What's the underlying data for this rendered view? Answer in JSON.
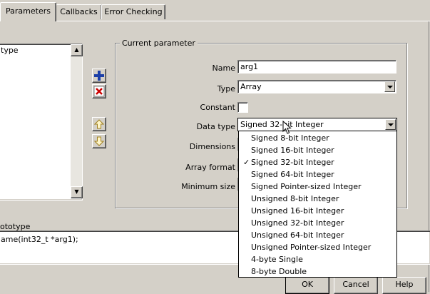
{
  "tabs": [
    {
      "label": "Parameters",
      "active": true
    },
    {
      "label": "Callbacks",
      "active": false
    },
    {
      "label": "Error Checking",
      "active": false
    }
  ],
  "param_list": {
    "items": [
      "type"
    ]
  },
  "group": {
    "title": "Current parameter"
  },
  "fields": {
    "name_label": "Name",
    "name_value": "arg1",
    "type_label": "Type",
    "type_value": "Array",
    "constant_label": "Constant",
    "datatype_label": "Data type",
    "datatype_value": "Signed 32-bit Integer",
    "dimensions_label": "Dimensions",
    "arrayformat_label": "Array format",
    "minsize_label": "Minimum size"
  },
  "dropdown_options": [
    {
      "label": "Signed 8-bit Integer",
      "checked": false
    },
    {
      "label": "Signed 16-bit Integer",
      "checked": false
    },
    {
      "label": "Signed 32-bit Integer",
      "checked": true
    },
    {
      "label": "Signed 64-bit Integer",
      "checked": false
    },
    {
      "label": "Signed Pointer-sized Integer",
      "checked": false
    },
    {
      "label": "Unsigned 8-bit Integer",
      "checked": false
    },
    {
      "label": "Unsigned 16-bit Integer",
      "checked": false
    },
    {
      "label": "Unsigned 32-bit Integer",
      "checked": false
    },
    {
      "label": "Unsigned 64-bit Integer",
      "checked": false
    },
    {
      "label": "Unsigned Pointer-sized Integer",
      "checked": false
    },
    {
      "label": "4-byte Single",
      "checked": false
    },
    {
      "label": "8-byte Double",
      "checked": false
    }
  ],
  "prototype": {
    "label": "ototype",
    "text": "ame(int32_t *arg1);"
  },
  "buttons": {
    "ok": "OK",
    "cancel": "Cancel",
    "help": "Help"
  },
  "icons": {
    "add": "plus-icon",
    "delete": "x-delete-icon",
    "up": "arrow-up-icon",
    "down": "arrow-down-icon",
    "check": "✓"
  },
  "colors": {
    "accent_blue": "#1c3fa8",
    "delete_red": "#cc0000",
    "arrow_green": "#c8a020"
  }
}
